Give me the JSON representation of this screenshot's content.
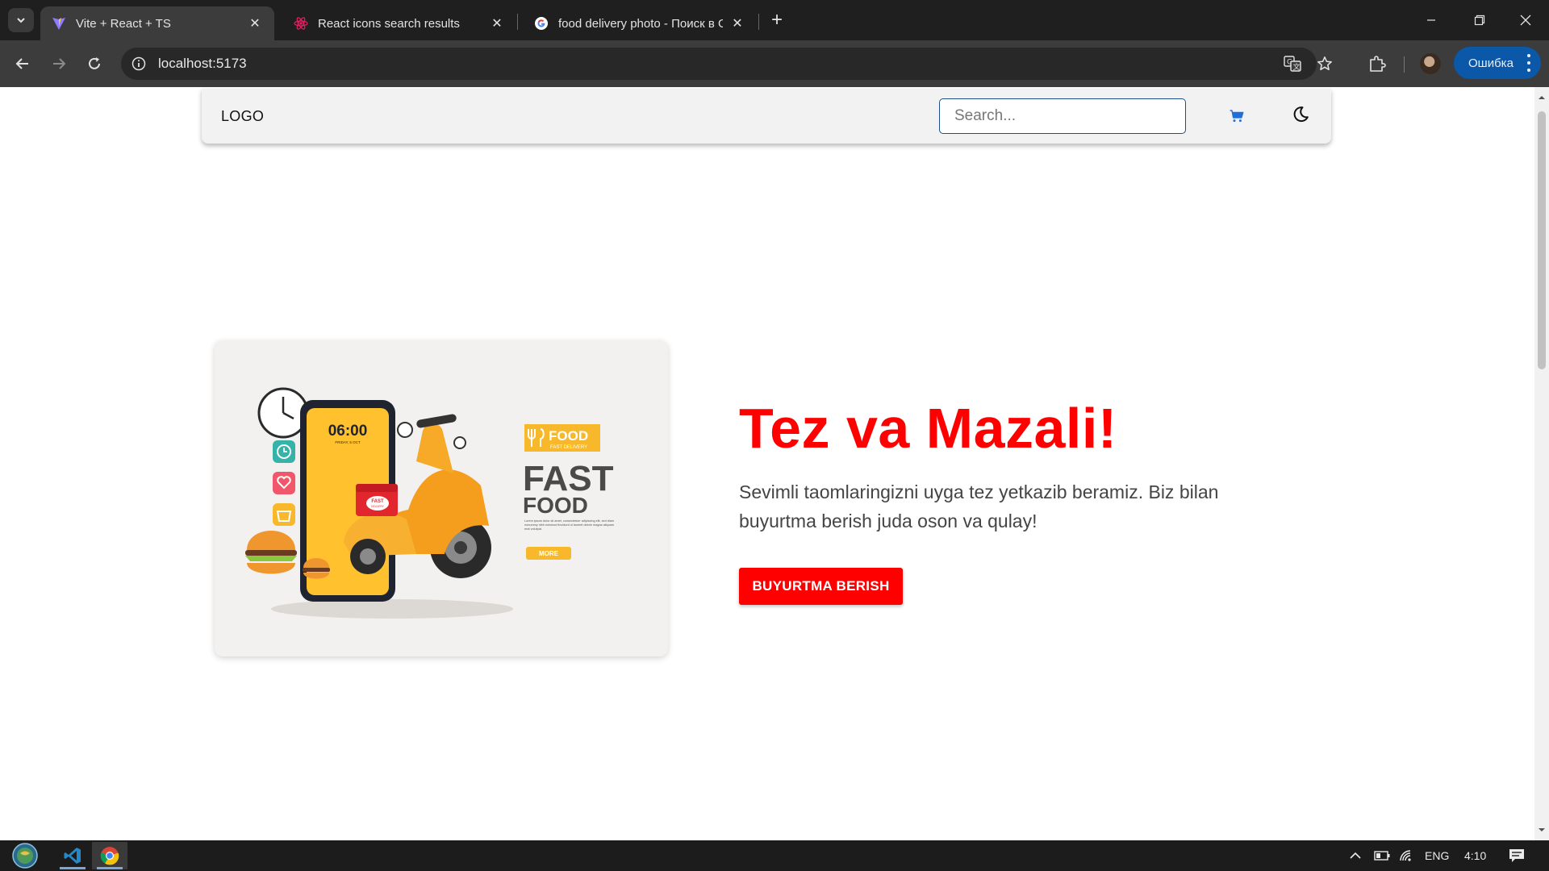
{
  "browser": {
    "tabs": [
      {
        "title": "Vite + React + TS",
        "favicon": "vite-icon",
        "active": true
      },
      {
        "title": "React icons search results",
        "favicon": "react-icon",
        "active": false
      },
      {
        "title": "food delivery photo - Поиск в Google",
        "favicon": "google-icon",
        "active": false
      }
    ],
    "url": "localhost:5173",
    "error_label": "Ошибка"
  },
  "app": {
    "navbar": {
      "logo": "LOGO",
      "search_placeholder": "Search...",
      "cart_icon": "cart-icon",
      "theme_icon": "moon-icon",
      "accent_color": "#1e6fd9"
    },
    "hero": {
      "title": "Tez va Mazali!",
      "text": "Sevimli taomlaringizni uyga tez yetkazib beramiz. Biz bilan buyurtma berish juda oson va qulay!",
      "button_label": "BUYURTMA BERISH",
      "title_color": "#ff0000",
      "image": {
        "clock": "06:00",
        "clock_sub": "FRIDAY, 5 OCT",
        "badge": "FOOD",
        "badge_sub": "FAST DELIVERY",
        "headline": "FAST",
        "subheadline": "FOOD",
        "box_label": "FAST",
        "box_sub": "DELIVERY",
        "more_label": "MORE",
        "body_text": "Lorem ipsum dolor sit amet, consectetuer adipiscing elit, sed diam nonummy nibh euismod tincidunt ut laoreet dolore magna aliquam erat volutpat."
      }
    }
  },
  "taskbar": {
    "language": "ENG",
    "time": "4:10"
  }
}
